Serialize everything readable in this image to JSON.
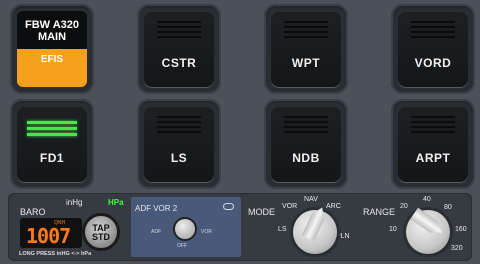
{
  "efis": {
    "title_line1": "FBW A320",
    "title_line2": "MAIN",
    "efis_label": "EFIS"
  },
  "buttons_row1": [
    "CSTR",
    "WPT",
    "VORD"
  ],
  "buttons_row2": [
    "FD1",
    "LS",
    "NDB",
    "ARPT"
  ],
  "baro": {
    "label": "BARO",
    "unit_inhg": "inHg",
    "unit_hpa": "HPa",
    "qnh_label": "QNH",
    "value": "1007",
    "tap_label_line1": "TAP",
    "tap_label_line2": "STD",
    "footer": "LONG PRESS inHG <-> hPa"
  },
  "adf_vor": {
    "label": "ADF VOR 2",
    "adf": "ADF",
    "vor": "VOR",
    "off": "OFF"
  },
  "mode": {
    "label": "MODE",
    "options": [
      "LS",
      "VOR",
      "NAV",
      "ARC",
      "PLN"
    ]
  },
  "range": {
    "label": "RANGE",
    "options": [
      "10",
      "20",
      "40",
      "80",
      "160",
      "320"
    ]
  },
  "colors": {
    "efis_accent": "#f4a11b",
    "fd_lit": "#45e64e",
    "hpa_green": "#3cff3c",
    "baro_digits": "#ff7a1a"
  }
}
